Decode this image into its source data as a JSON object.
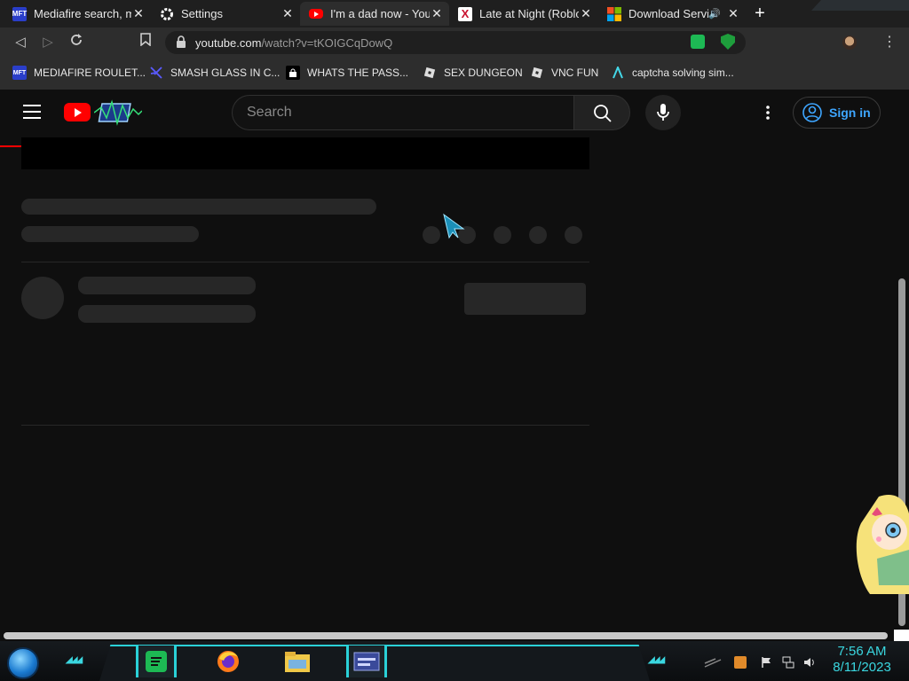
{
  "tabs": [
    {
      "title": "Mediafire search, me",
      "favicon": "MFT"
    },
    {
      "title": "Settings",
      "favicon": "gear-icon"
    },
    {
      "title": "I'm a dad now - YouT",
      "favicon": "youtube-icon"
    },
    {
      "title": "Late at Night (Roblox",
      "favicon": "x-icon"
    },
    {
      "title": "Download Servic",
      "favicon": "microsoft-icon"
    }
  ],
  "address_bar": {
    "domain": "youtube.com",
    "path": "/watch?v=tKOIGCqDowQ"
  },
  "bookmarks": [
    {
      "label": "MEDIAFIRE ROULET...",
      "icon": "MFT"
    },
    {
      "label": "SMASH GLASS IN C...",
      "icon": "shatter-icon"
    },
    {
      "label": "WHATS THE PASS...",
      "icon": "lock-icon"
    },
    {
      "label": "SEX DUNGEON",
      "icon": "roblox-icon"
    },
    {
      "label": "VNC FUN",
      "icon": "roblox-icon"
    },
    {
      "label": "captcha solving sim...",
      "icon": "a-icon"
    }
  ],
  "youtube": {
    "search_placeholder": "Search",
    "signin_label": "Sign in"
  },
  "taskbar": {
    "time": "7:56 AM",
    "date": "8/11/2023"
  },
  "colors": {
    "accent": "#3ad7e0",
    "youtube_red": "#ff0000",
    "link_blue": "#3ea6ff"
  }
}
